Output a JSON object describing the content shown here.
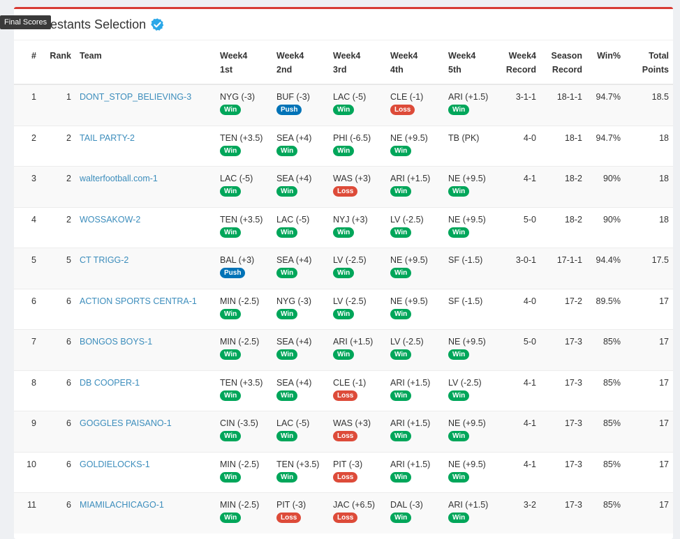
{
  "tooltip": "Final Scores",
  "panel": {
    "title": "Contestants Selection"
  },
  "colors": {
    "accent_top": "#d73c34",
    "link": "#3c8dbc",
    "win": "#00a65a",
    "loss": "#dd4b39",
    "push": "#0073b7"
  },
  "table": {
    "headers": {
      "num": "#",
      "rank": "Rank",
      "team": "Team",
      "w1a": "Week4",
      "w1b": "1st",
      "w2a": "Week4",
      "w2b": "2nd",
      "w3a": "Week4",
      "w3b": "3rd",
      "w4a": "Week4",
      "w4b": "4th",
      "w5a": "Week4",
      "w5b": "5th",
      "reca": "Week4",
      "recb": "Record",
      "seasa": "Season",
      "seasb": "Record",
      "win": "Win%",
      "tpa": "Total",
      "tpb": "Points"
    },
    "rows": [
      {
        "num": "1",
        "rank": "1",
        "team": "DONT_STOP_BELIEVING-3",
        "picks": [
          {
            "t": "NYG (-3)",
            "r": "Win"
          },
          {
            "t": "BUF (-3)",
            "r": "Push"
          },
          {
            "t": "LAC (-5)",
            "r": "Win"
          },
          {
            "t": "CLE (-1)",
            "r": "Loss"
          },
          {
            "t": "ARI (+1.5)",
            "r": "Win"
          }
        ],
        "wrec": "3-1-1",
        "srec": "18-1-1",
        "winpct": "94.7%",
        "pts": "18.5"
      },
      {
        "num": "2",
        "rank": "2",
        "team": "TAIL PARTY-2",
        "picks": [
          {
            "t": "TEN (+3.5)",
            "r": "Win"
          },
          {
            "t": "SEA (+4)",
            "r": "Win"
          },
          {
            "t": "PHI (-6.5)",
            "r": "Win"
          },
          {
            "t": "NE (+9.5)",
            "r": "Win"
          },
          {
            "t": "TB (PK)",
            "r": ""
          }
        ],
        "wrec": "4-0",
        "srec": "18-1",
        "winpct": "94.7%",
        "pts": "18"
      },
      {
        "num": "3",
        "rank": "2",
        "team": "walterfootball.com-1",
        "picks": [
          {
            "t": "LAC (-5)",
            "r": "Win"
          },
          {
            "t": "SEA (+4)",
            "r": "Win"
          },
          {
            "t": "WAS (+3)",
            "r": "Loss"
          },
          {
            "t": "ARI (+1.5)",
            "r": "Win"
          },
          {
            "t": "NE (+9.5)",
            "r": "Win"
          }
        ],
        "wrec": "4-1",
        "srec": "18-2",
        "winpct": "90%",
        "pts": "18"
      },
      {
        "num": "4",
        "rank": "2",
        "team": "WOSSAKOW-2",
        "picks": [
          {
            "t": "TEN (+3.5)",
            "r": "Win"
          },
          {
            "t": "LAC (-5)",
            "r": "Win"
          },
          {
            "t": "NYJ (+3)",
            "r": "Win"
          },
          {
            "t": "LV (-2.5)",
            "r": "Win"
          },
          {
            "t": "NE (+9.5)",
            "r": "Win"
          }
        ],
        "wrec": "5-0",
        "srec": "18-2",
        "winpct": "90%",
        "pts": "18"
      },
      {
        "num": "5",
        "rank": "5",
        "team": "CT TRIGG-2",
        "picks": [
          {
            "t": "BAL (+3)",
            "r": "Push"
          },
          {
            "t": "SEA (+4)",
            "r": "Win"
          },
          {
            "t": "LV (-2.5)",
            "r": "Win"
          },
          {
            "t": "NE (+9.5)",
            "r": "Win"
          },
          {
            "t": "SF (-1.5)",
            "r": ""
          }
        ],
        "wrec": "3-0-1",
        "srec": "17-1-1",
        "winpct": "94.4%",
        "pts": "17.5"
      },
      {
        "num": "6",
        "rank": "6",
        "team": "ACTION SPORTS CENTRA-1",
        "picks": [
          {
            "t": "MIN (-2.5)",
            "r": "Win"
          },
          {
            "t": "NYG (-3)",
            "r": "Win"
          },
          {
            "t": "LV (-2.5)",
            "r": "Win"
          },
          {
            "t": "NE (+9.5)",
            "r": "Win"
          },
          {
            "t": "SF (-1.5)",
            "r": ""
          }
        ],
        "wrec": "4-0",
        "srec": "17-2",
        "winpct": "89.5%",
        "pts": "17"
      },
      {
        "num": "7",
        "rank": "6",
        "team": "BONGOS BOYS-1",
        "picks": [
          {
            "t": "MIN (-2.5)",
            "r": "Win"
          },
          {
            "t": "SEA (+4)",
            "r": "Win"
          },
          {
            "t": "ARI (+1.5)",
            "r": "Win"
          },
          {
            "t": "LV (-2.5)",
            "r": "Win"
          },
          {
            "t": "NE (+9.5)",
            "r": "Win"
          }
        ],
        "wrec": "5-0",
        "srec": "17-3",
        "winpct": "85%",
        "pts": "17"
      },
      {
        "num": "8",
        "rank": "6",
        "team": "DB COOPER-1",
        "picks": [
          {
            "t": "TEN (+3.5)",
            "r": "Win"
          },
          {
            "t": "SEA (+4)",
            "r": "Win"
          },
          {
            "t": "CLE (-1)",
            "r": "Loss"
          },
          {
            "t": "ARI (+1.5)",
            "r": "Win"
          },
          {
            "t": "LV (-2.5)",
            "r": "Win"
          }
        ],
        "wrec": "4-1",
        "srec": "17-3",
        "winpct": "85%",
        "pts": "17"
      },
      {
        "num": "9",
        "rank": "6",
        "team": "GOGGLES PAISANO-1",
        "picks": [
          {
            "t": "CIN (-3.5)",
            "r": "Win"
          },
          {
            "t": "LAC (-5)",
            "r": "Win"
          },
          {
            "t": "WAS (+3)",
            "r": "Loss"
          },
          {
            "t": "ARI (+1.5)",
            "r": "Win"
          },
          {
            "t": "NE (+9.5)",
            "r": "Win"
          }
        ],
        "wrec": "4-1",
        "srec": "17-3",
        "winpct": "85%",
        "pts": "17"
      },
      {
        "num": "10",
        "rank": "6",
        "team": "GOLDIELOCKS-1",
        "picks": [
          {
            "t": "MIN (-2.5)",
            "r": "Win"
          },
          {
            "t": "TEN (+3.5)",
            "r": "Win"
          },
          {
            "t": "PIT (-3)",
            "r": "Loss"
          },
          {
            "t": "ARI (+1.5)",
            "r": "Win"
          },
          {
            "t": "NE (+9.5)",
            "r": "Win"
          }
        ],
        "wrec": "4-1",
        "srec": "17-3",
        "winpct": "85%",
        "pts": "17"
      },
      {
        "num": "11",
        "rank": "6",
        "team": "MIAMILACHICAGO-1",
        "picks": [
          {
            "t": "MIN (-2.5)",
            "r": "Win"
          },
          {
            "t": "PIT (-3)",
            "r": "Loss"
          },
          {
            "t": "JAC (+6.5)",
            "r": "Loss"
          },
          {
            "t": "DAL (-3)",
            "r": "Win"
          },
          {
            "t": "ARI (+1.5)",
            "r": "Win"
          }
        ],
        "wrec": "3-2",
        "srec": "17-3",
        "winpct": "85%",
        "pts": "17"
      }
    ]
  }
}
